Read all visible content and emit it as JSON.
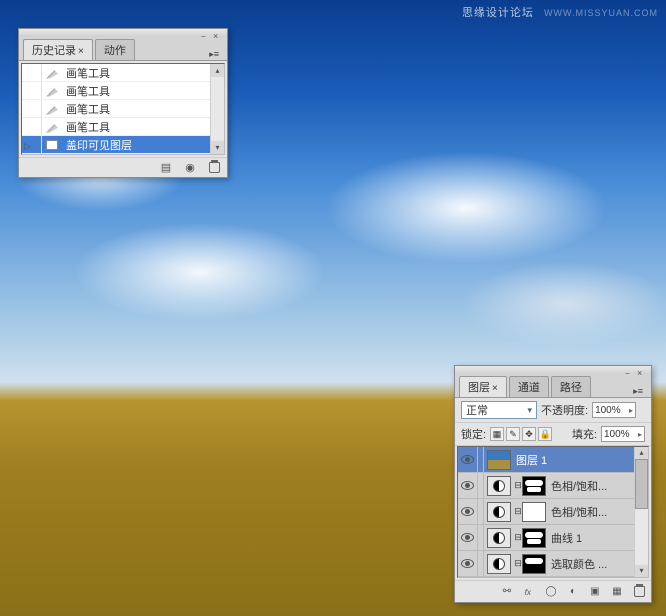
{
  "watermark": {
    "text": "思缘设计论坛",
    "url": "WWW.MISSYUAN.COM"
  },
  "history": {
    "tabs": {
      "history": "历史记录",
      "actions": "动作"
    },
    "items": [
      {
        "label": "画笔工具",
        "type": "brush"
      },
      {
        "label": "画笔工具",
        "type": "brush"
      },
      {
        "label": "画笔工具",
        "type": "brush"
      },
      {
        "label": "画笔工具",
        "type": "brush"
      },
      {
        "label": "盖印可见图层",
        "type": "stamp",
        "selected": true
      }
    ]
  },
  "layers": {
    "tabs": {
      "layers": "图层",
      "channels": "通道",
      "paths": "路径"
    },
    "blend_label": "正常",
    "opacity_label": "不透明度:",
    "opacity_value": "100%",
    "lock_label": "锁定:",
    "fill_label": "填充:",
    "fill_value": "100%",
    "items": [
      {
        "name": "图层 1",
        "type": "image",
        "selected": true
      },
      {
        "name": "色相/饱和...",
        "type": "adj",
        "mask": "blob"
      },
      {
        "name": "色相/饱和...",
        "type": "adj",
        "mask": "white"
      },
      {
        "name": "曲线 1",
        "type": "adj",
        "mask": "blob"
      },
      {
        "name": "选取颜色 ...",
        "type": "adj",
        "mask": "blob"
      }
    ]
  }
}
